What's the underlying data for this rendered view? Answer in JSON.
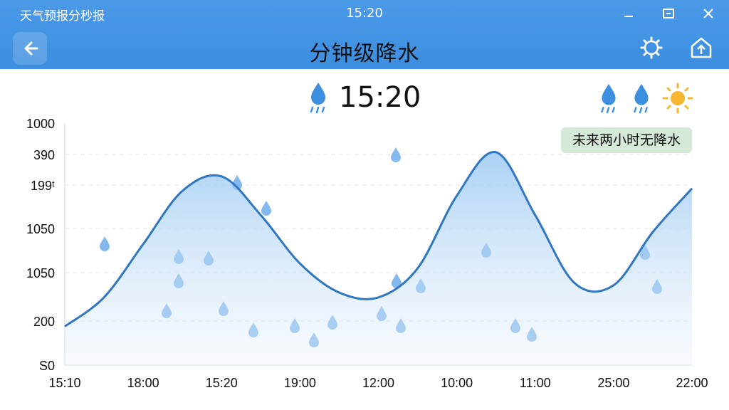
{
  "window": {
    "title": "天气预报分秒报",
    "time": "15:20"
  },
  "header": {
    "title": "分钟级降水"
  },
  "current": {
    "time": "15:20"
  },
  "icons": {
    "back": "back-arrow-icon",
    "settings": "gear-icon",
    "home": "home-icon",
    "condition_1": "rain-icon",
    "condition_2": "rain-icon",
    "condition_3": "sun-icon"
  },
  "badge": {
    "text": "未来两小时无降水"
  },
  "colors": {
    "accent": "#4a9ae8",
    "line": "#2f76c5",
    "badge_bg": "#d4e9d7",
    "sun": "#f7b731"
  },
  "chart_data": {
    "type": "area",
    "y_tick_labels": [
      "1000",
      "390",
      "199ᵗ",
      "1050",
      "1050",
      "200",
      "S0"
    ],
    "x_tick_labels": [
      "15:10",
      "18:00",
      "15:20",
      "19:00",
      "12:00",
      "10:00",
      "11:00",
      "25:00",
      "22:00"
    ],
    "grid": true,
    "series": [
      {
        "x": [
          0,
          0.5,
          1,
          1.5,
          2,
          2.5,
          3,
          3.5,
          4,
          4.5,
          5,
          5.5,
          6,
          6.5,
          7,
          7.5,
          8
        ],
        "values": [
          0.16,
          0.28,
          0.5,
          0.72,
          0.78,
          0.62,
          0.42,
          0.3,
          0.28,
          0.4,
          0.7,
          0.88,
          0.62,
          0.34,
          0.33,
          0.55,
          0.73
        ]
      }
    ]
  }
}
